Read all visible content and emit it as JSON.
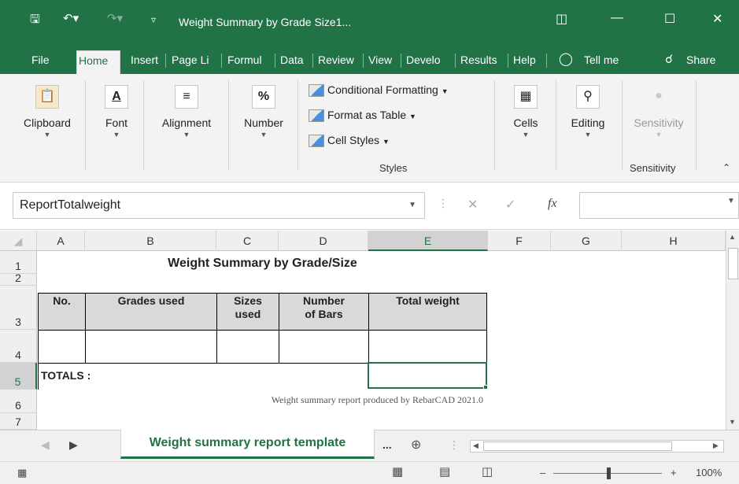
{
  "window": {
    "title": "Weight Summary by Grade Size1..."
  },
  "ribbon": {
    "tabs": [
      "File",
      "Home",
      "Insert",
      "Page Li",
      "Formul",
      "Data",
      "Review",
      "View",
      "Develo",
      "Results",
      "Help"
    ],
    "active_tab": "Home",
    "tell_me": "Tell me",
    "share": "Share",
    "groups": {
      "clipboard": "Clipboard",
      "font": "Font",
      "alignment": "Alignment",
      "number": "Number",
      "conditional_formatting": "Conditional Formatting",
      "format_as_table": "Format as Table",
      "cell_styles": "Cell Styles",
      "styles_label": "Styles",
      "cells": "Cells",
      "editing": "Editing",
      "sensitivity_button": "Sensitivity",
      "sensitivity_label": "Sensitivity"
    },
    "accent_color": "#217346"
  },
  "formula_bar": {
    "name_box": "ReportTotalweight",
    "formula_value": ""
  },
  "grid": {
    "columns": [
      "A",
      "B",
      "C",
      "D",
      "E",
      "F",
      "G",
      "H"
    ],
    "rows": [
      "1",
      "2",
      "3",
      "4",
      "5",
      "6",
      "7"
    ],
    "selected_column": "E",
    "selected_row": "5",
    "title": "Weight Summary by Grade/Size",
    "headers": {
      "no": "No.",
      "grades_used": "Grades used",
      "sizes_used_1": "Sizes",
      "sizes_used_2": "used",
      "number_of_bars_1": "Number",
      "number_of_bars_2": "of Bars",
      "total_weight": "Total weight"
    },
    "totals_label": "TOTALS  :",
    "footnote": "Weight summary report produced by RebarCAD 2021.0"
  },
  "sheets": {
    "active_sheet": "Weight summary report template",
    "more": "..."
  },
  "status": {
    "zoom": "100%"
  }
}
